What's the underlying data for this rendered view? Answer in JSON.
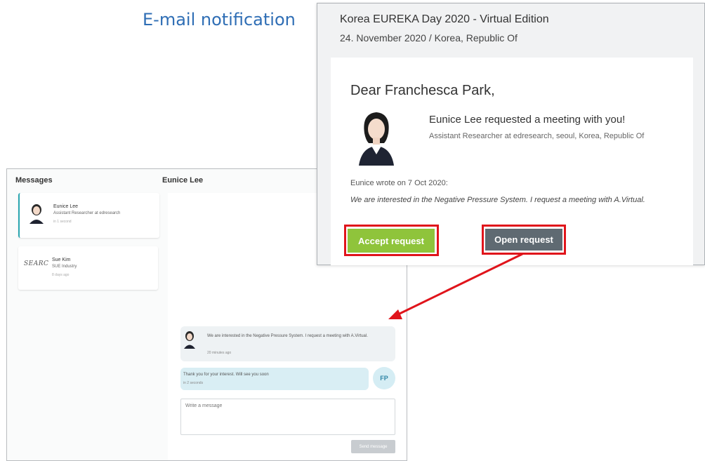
{
  "caption": "E-mail notification",
  "messages_app": {
    "messages_header": "Messages",
    "chat_header": "Eunice Lee",
    "contacts": [
      {
        "name": "Eunice Lee",
        "subtitle": "Assistant Researcher at edresearch",
        "time": "in 1 second"
      },
      {
        "name": "Sue Kim",
        "subtitle": "SUE Industry",
        "time": "8 days ago",
        "logo_text": "SEARC"
      }
    ],
    "incoming_message": {
      "text": "We are interested in the Negative Pressure System. I request a meeting with A.Virtual.",
      "time": "20 minutes ago"
    },
    "outgoing_message": {
      "text": "Thank you for your interest. Will see you soon",
      "time": "in 2 seconds",
      "avatar_initials": "FP"
    },
    "compose_placeholder": "Write a message",
    "send_label": "Send message"
  },
  "email": {
    "event_title": "Korea EUREKA Day 2020 - Virtual Edition",
    "event_date": "24. November 2020 / Korea, Republic Of",
    "greeting": "Dear Franchesca Park,",
    "request_text": "Eunice Lee requested a meeting with you!",
    "requester_role": "Assistant Researcher at edresearch, seoul, Korea, Republic Of",
    "wrote_line": "Eunice wrote on 7 Oct 2020:",
    "quote": "We are interested in the Negative Pressure System. I request a meeting with A.Virtual.",
    "accept_label": "Accept request",
    "open_label": "Open request"
  },
  "colors": {
    "caption": "#2f6eb5",
    "accept": "#8fc43b",
    "open": "#5f6a72",
    "highlight": "#e0141b",
    "active_contact": "#2aa6b0"
  }
}
